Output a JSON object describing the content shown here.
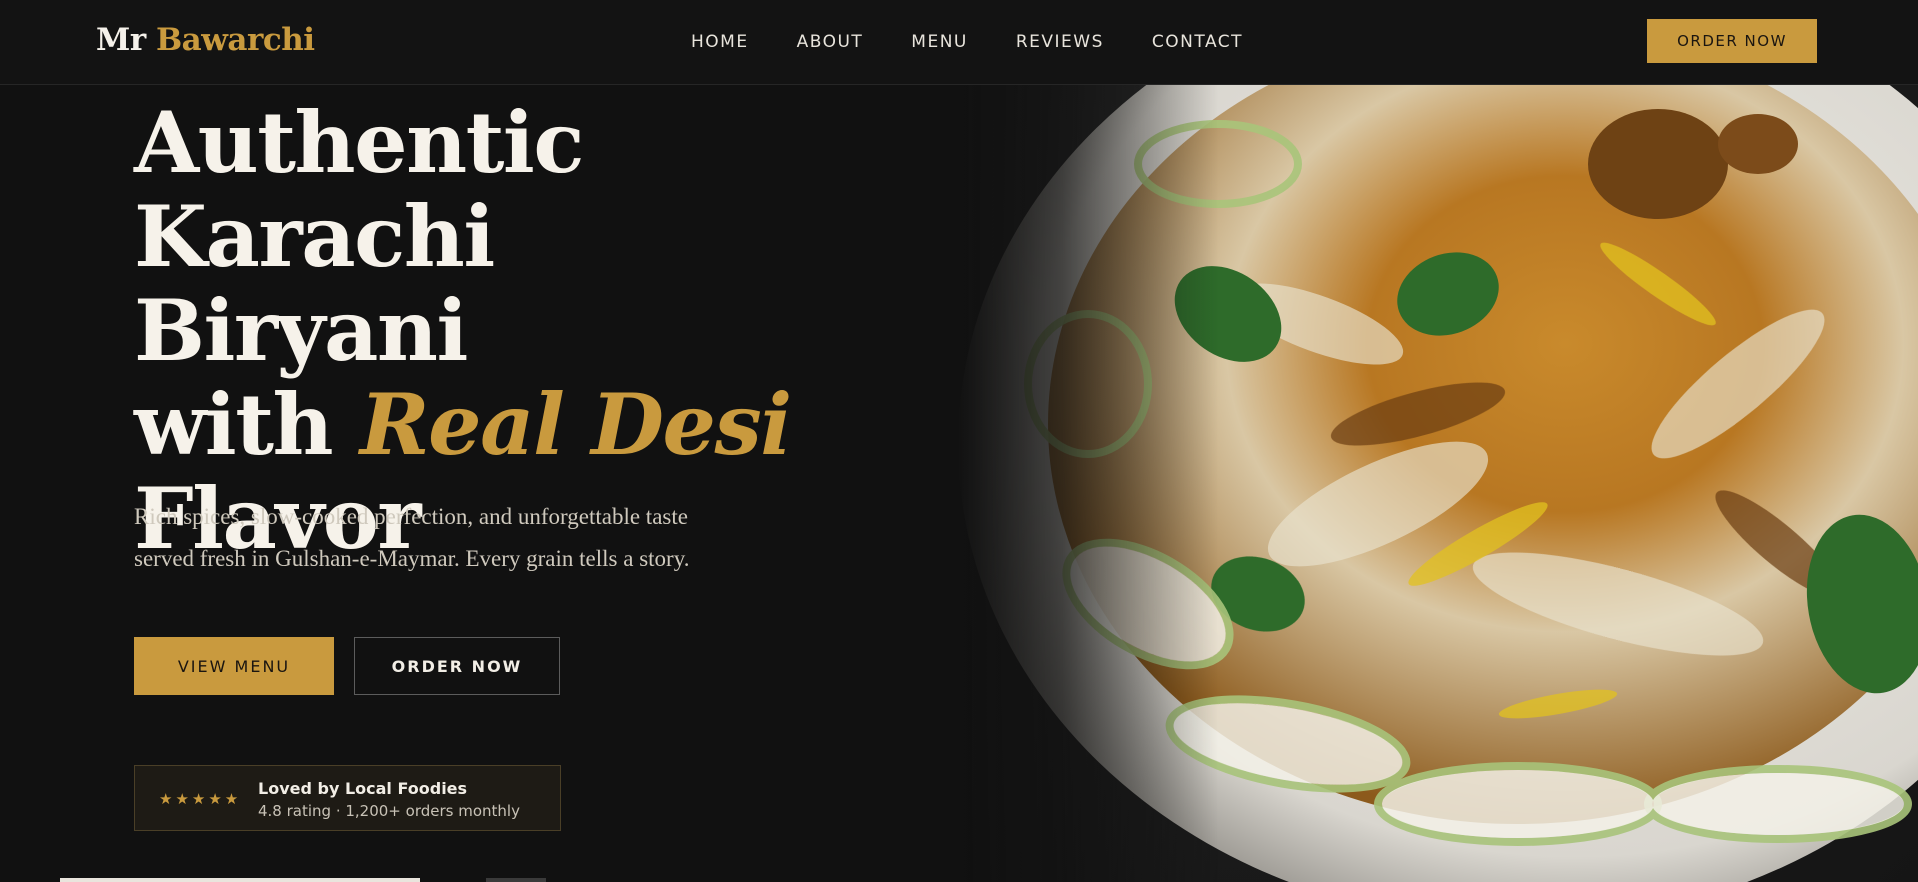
{
  "brand": {
    "first": "Mr",
    "second": "Bawarchi"
  },
  "nav": {
    "links": [
      "HOME",
      "ABOUT",
      "MENU",
      "REVIEWS",
      "CONTACT"
    ],
    "cta": "ORDER NOW"
  },
  "hero": {
    "line1": "Authentic Karachi",
    "line2": "Biryani",
    "line3_prefix": "with",
    "line3_accent": "Real Desi",
    "line4": "Flavor",
    "subtitle_line1": "Rich spices, slow-cooked perfection, and unforgettable taste",
    "subtitle_line2": "served fresh in Gulshan-e-Maymar. Every grain tells a story.",
    "primary_button": "VIEW MENU",
    "secondary_button": "ORDER NOW"
  },
  "rating_badge": {
    "stars": "★★★★★",
    "title": "Loved by Local Foodies",
    "meta": "4.8 rating · 1,200+ orders monthly"
  },
  "colors": {
    "accent": "#c99a3e",
    "background": "#111111",
    "text": "#f2eee6"
  },
  "icons": {
    "rating": "star-icon"
  }
}
